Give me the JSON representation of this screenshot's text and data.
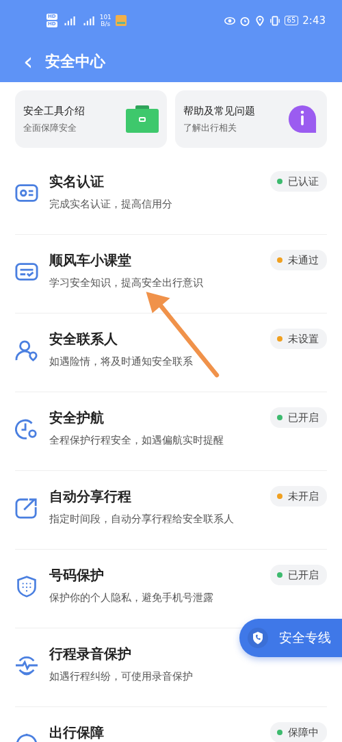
{
  "status_bar": {
    "hd": [
      "HD",
      "HD"
    ],
    "speed_value": "101",
    "speed_unit": "B/s",
    "battery": "65",
    "time": "2:43"
  },
  "header": {
    "back": "‹",
    "title": "安全中心"
  },
  "quick_cards": [
    {
      "kind": "toolbox",
      "title": "安全工具介绍",
      "subtitle": "全面保障安全"
    },
    {
      "kind": "info",
      "title": "帮助及常见问题",
      "subtitle": "了解出行相关"
    }
  ],
  "items": [
    {
      "kind": "id-card",
      "title": "实名认证",
      "desc": "完成实名认证，提高信用分",
      "status": {
        "label": "已认证",
        "color": "#3dba6e"
      }
    },
    {
      "kind": "lesson",
      "title": "顺风车小课堂",
      "desc": "学习安全知识，提高安全出行意识",
      "status": {
        "label": "未通过",
        "color": "#f0a020"
      }
    },
    {
      "kind": "contact",
      "title": "安全联系人",
      "desc": "如遇险情，将及时通知安全联系",
      "status": {
        "label": "未设置",
        "color": "#f0a020"
      }
    },
    {
      "kind": "navigation",
      "title": "安全护航",
      "desc": "全程保护行程安全，如遇偏航实时提醒",
      "status": {
        "label": "已开启",
        "color": "#3dba6e"
      }
    },
    {
      "kind": "share",
      "title": "自动分享行程",
      "desc": "指定时间段，自动分享行程给安全联系人",
      "status": {
        "label": "未开启",
        "color": "#f0a020"
      }
    },
    {
      "kind": "shield",
      "title": "号码保护",
      "desc": "保护你的个人隐私，避免手机号泄露",
      "status": {
        "label": "已开启",
        "color": "#3dba6e"
      }
    },
    {
      "kind": "recording",
      "title": "行程录音保护",
      "desc": "如遇行程纠纷，可使用录音保护"
    },
    {
      "kind": "guarantee",
      "title": "出行保障",
      "status": {
        "label": "保障中",
        "color": "#3dba6e"
      }
    }
  ],
  "hotline": {
    "label": "安全专线"
  }
}
